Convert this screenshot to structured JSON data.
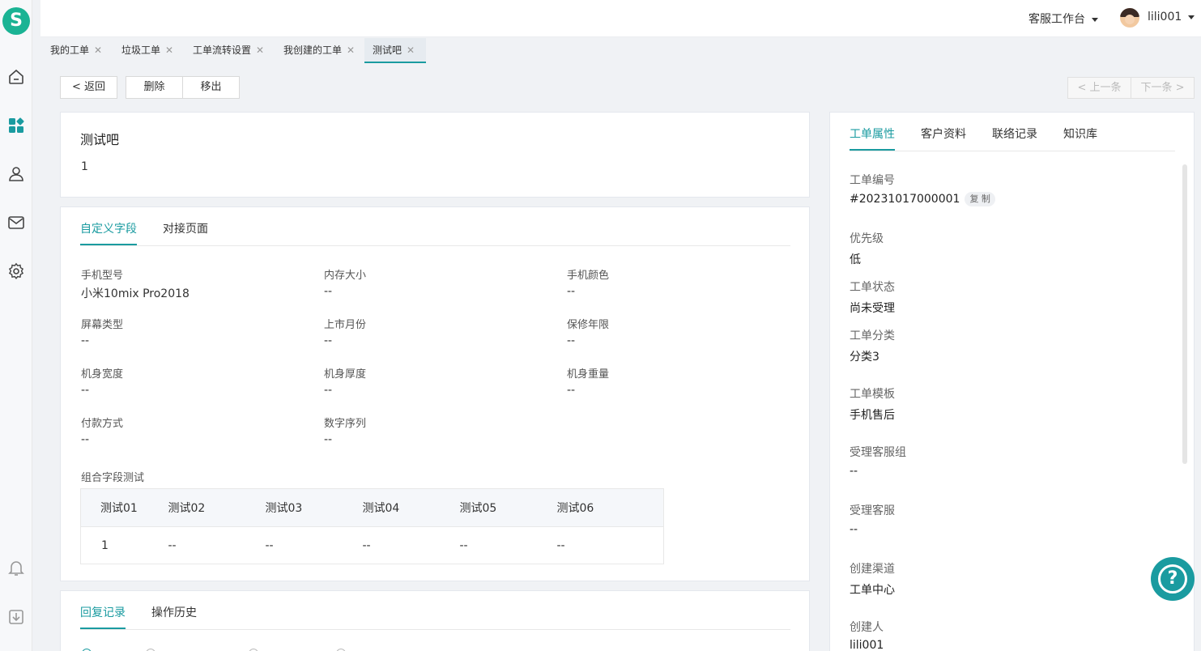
{
  "app": {
    "logo_letter": "S"
  },
  "sidebar": {
    "icons": [
      "home-icon",
      "apps-icon",
      "customer-icon",
      "mail-icon",
      "settings-icon",
      "bell-icon",
      "download-icon"
    ]
  },
  "header": {
    "workbench": "客服工作台",
    "username": "lili001"
  },
  "tabs": [
    {
      "label": "我的工单"
    },
    {
      "label": "垃圾工单"
    },
    {
      "label": "工单流转设置"
    },
    {
      "label": "我创建的工单"
    },
    {
      "label": "测试吧"
    }
  ],
  "toolbar": {
    "back": "返回",
    "delete": "删除",
    "move_out": "移出",
    "prev": "上一条",
    "next": "下一条"
  },
  "ticket": {
    "title": "测试吧",
    "content": "1"
  },
  "fields_card": {
    "tabs": [
      "自定义字段",
      "对接页面"
    ],
    "fields": [
      {
        "label": "手机型号",
        "value": "小米10mix Pro2018"
      },
      {
        "label": "内存大小",
        "value": "--"
      },
      {
        "label": "手机颜色",
        "value": "--"
      },
      {
        "label": "屏幕类型",
        "value": "--"
      },
      {
        "label": "上市月份",
        "value": "--"
      },
      {
        "label": "保修年限",
        "value": "--"
      },
      {
        "label": "机身宽度",
        "value": "--"
      },
      {
        "label": "机身厚度",
        "value": "--"
      },
      {
        "label": "机身重量",
        "value": "--"
      },
      {
        "label": "付款方式",
        "value": "--"
      },
      {
        "label": "数字序列",
        "value": "--"
      }
    ],
    "combo_label": "组合字段测试",
    "combo_headers": [
      "测试01",
      "测试02",
      "测试03",
      "测试04",
      "测试05",
      "测试06"
    ],
    "combo_rows": [
      [
        "1",
        "--",
        "--",
        "--",
        "--",
        "--"
      ]
    ]
  },
  "records_card": {
    "tabs": [
      "回复记录",
      "操作历史"
    ]
  },
  "props_card": {
    "tabs": [
      "工单属性",
      "客户资料",
      "联络记录",
      "知识库"
    ],
    "ticket_no_label": "工单编号",
    "ticket_no": "#20231017000001",
    "copy": "复 制",
    "items": [
      {
        "label": "优先级",
        "value": "低"
      },
      {
        "label": "工单状态",
        "value": "尚未受理"
      },
      {
        "label": "工单分类",
        "value": "分类3"
      },
      {
        "label": "工单模板",
        "value": "手机售后"
      },
      {
        "label": "受理客服组",
        "value": "--"
      },
      {
        "label": "受理客服",
        "value": "--"
      },
      {
        "label": "创建渠道",
        "value": "工单中心"
      },
      {
        "label": "创建人",
        "value": "lili001"
      }
    ]
  },
  "help": {
    "symbol": "?"
  },
  "colors": {
    "accent": "#1a9ba0",
    "logo": "#1ab394"
  }
}
